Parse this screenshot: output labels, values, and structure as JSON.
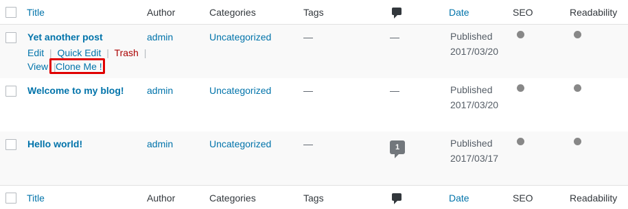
{
  "columns": {
    "title": "Title",
    "author": "Author",
    "categories": "Categories",
    "tags": "Tags",
    "comments_icon": "comment-bubble-icon",
    "date": "Date",
    "seo": "SEO",
    "readability": "Readability"
  },
  "row_actions": {
    "edit": "Edit",
    "quick_edit": "Quick Edit",
    "trash": "Trash",
    "view": "View",
    "clone": "Clone Me !",
    "separator": "|"
  },
  "posts": [
    {
      "title": "Yet another post",
      "author": "admin",
      "category": "Uncategorized",
      "tags": "—",
      "comments": "—",
      "status": "Published",
      "date": "2017/03/20"
    },
    {
      "title": "Welcome to my blog!",
      "author": "admin",
      "category": "Uncategorized",
      "tags": "—",
      "comments": "—",
      "status": "Published",
      "date": "2017/03/20"
    },
    {
      "title": "Hello world!",
      "author": "admin",
      "category": "Uncategorized",
      "tags": "—",
      "comments": "1",
      "status": "Published",
      "date": "2017/03/17"
    }
  ],
  "colors": {
    "link": "#0073aa",
    "trash": "#aa0000",
    "highlight": "#e00000",
    "status_dot": "#888888"
  }
}
